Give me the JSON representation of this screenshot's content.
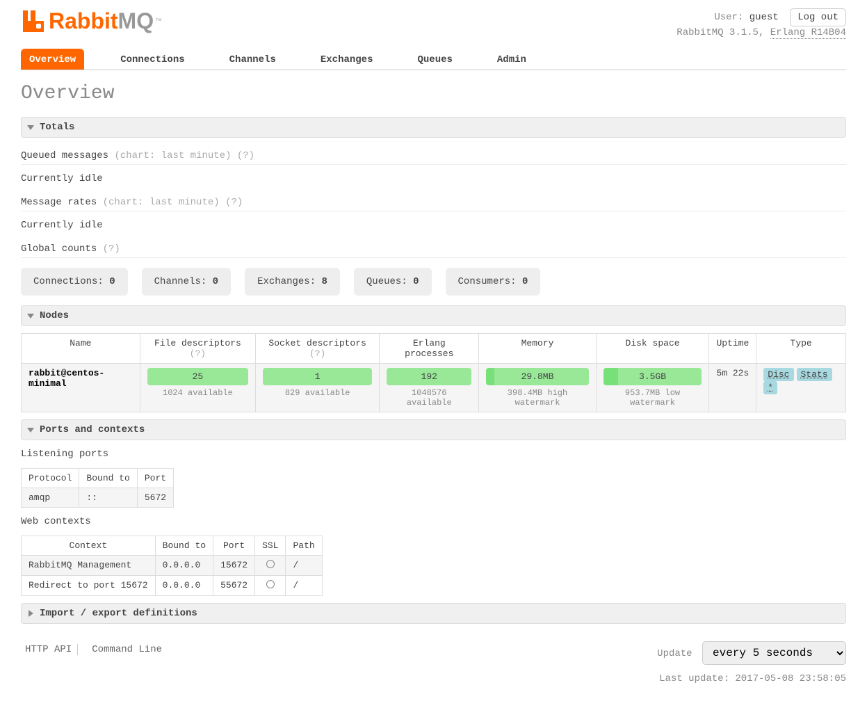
{
  "header": {
    "logo_brand": "Rabbit",
    "logo_suffix": "MQ",
    "user_label": "User:",
    "user": "guest",
    "version_prefix": "RabbitMQ",
    "version": "3.1.5",
    "erlang_prefix": "Erlang",
    "erlang": "R14B04",
    "logout": "Log out"
  },
  "tabs": [
    "Overview",
    "Connections",
    "Channels",
    "Exchanges",
    "Queues",
    "Admin"
  ],
  "page_title": "Overview",
  "sections": {
    "totals": "Totals",
    "nodes": "Nodes",
    "ports": "Ports and contexts",
    "import": "Import / export definitions"
  },
  "totals": {
    "queued_label": "Queued messages",
    "queued_sub": "(chart: last minute)",
    "q": "(?)",
    "idle1": "Currently idle",
    "rates_label": "Message rates",
    "rates_sub": "(chart: last minute)",
    "idle2": "Currently idle",
    "global_label": "Global counts",
    "counts": [
      {
        "label": "Connections:",
        "value": "0"
      },
      {
        "label": "Channels:",
        "value": "0"
      },
      {
        "label": "Exchanges:",
        "value": "8"
      },
      {
        "label": "Queues:",
        "value": "0"
      },
      {
        "label": "Consumers:",
        "value": "0"
      }
    ]
  },
  "nodes": {
    "headers": [
      "Name",
      "File descriptors",
      "Socket descriptors",
      "Erlang processes",
      "Memory",
      "Disk space",
      "Uptime",
      "Type"
    ],
    "row": {
      "name": "rabbit@centos-minimal",
      "fd": "25",
      "fd_avail": "1024 available",
      "sd": "1",
      "sd_avail": "829 available",
      "ep": "192",
      "ep_avail": "1048576 available",
      "mem": "29.8MB",
      "mem_sub": "398.4MB high watermark",
      "disk": "3.5GB",
      "disk_sub": "953.7MB low watermark",
      "uptime": "5m 22s",
      "type_disc": "Disc",
      "type_stats": "Stats",
      "type_star": "*"
    }
  },
  "ports": {
    "listening_title": "Listening ports",
    "lp_headers": [
      "Protocol",
      "Bound to",
      "Port"
    ],
    "lp_row": {
      "protocol": "amqp",
      "bound": "::",
      "port": "5672"
    },
    "web_title": "Web contexts",
    "wc_headers": [
      "Context",
      "Bound to",
      "Port",
      "SSL",
      "Path"
    ],
    "wc_rows": [
      {
        "context": "RabbitMQ Management",
        "bound": "0.0.0.0",
        "port": "15672",
        "path": "/"
      },
      {
        "context": "Redirect to port 15672",
        "bound": "0.0.0.0",
        "port": "55672",
        "path": "/"
      }
    ]
  },
  "footer": {
    "http_api": "HTTP API",
    "cmd": "Command Line",
    "update_label": "Update",
    "update_value": "every 5 seconds",
    "last_update": "Last update: 2017-05-08 23:58:05"
  }
}
